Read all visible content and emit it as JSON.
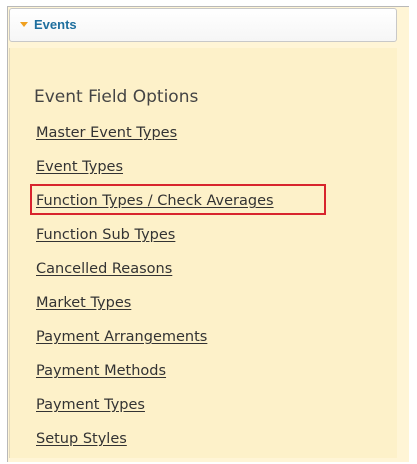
{
  "header": {
    "title": "Events",
    "toggle_icon": "caret-down-icon",
    "accent_color": "#f0a020",
    "title_color": "#1f6f9e"
  },
  "panel": {
    "background": "#fdf1c9",
    "section_title": "Event Field Options",
    "links": [
      "Master Event Types",
      "Event Types",
      "Function Types / Check Averages",
      "Function Sub Types",
      "Cancelled Reasons",
      "Market Types",
      "Payment Arrangements",
      "Payment Methods",
      "Payment Types",
      "Setup Styles"
    ],
    "highlighted_link": "Function Types / Check Averages",
    "highlight_color": "#d8242d"
  }
}
